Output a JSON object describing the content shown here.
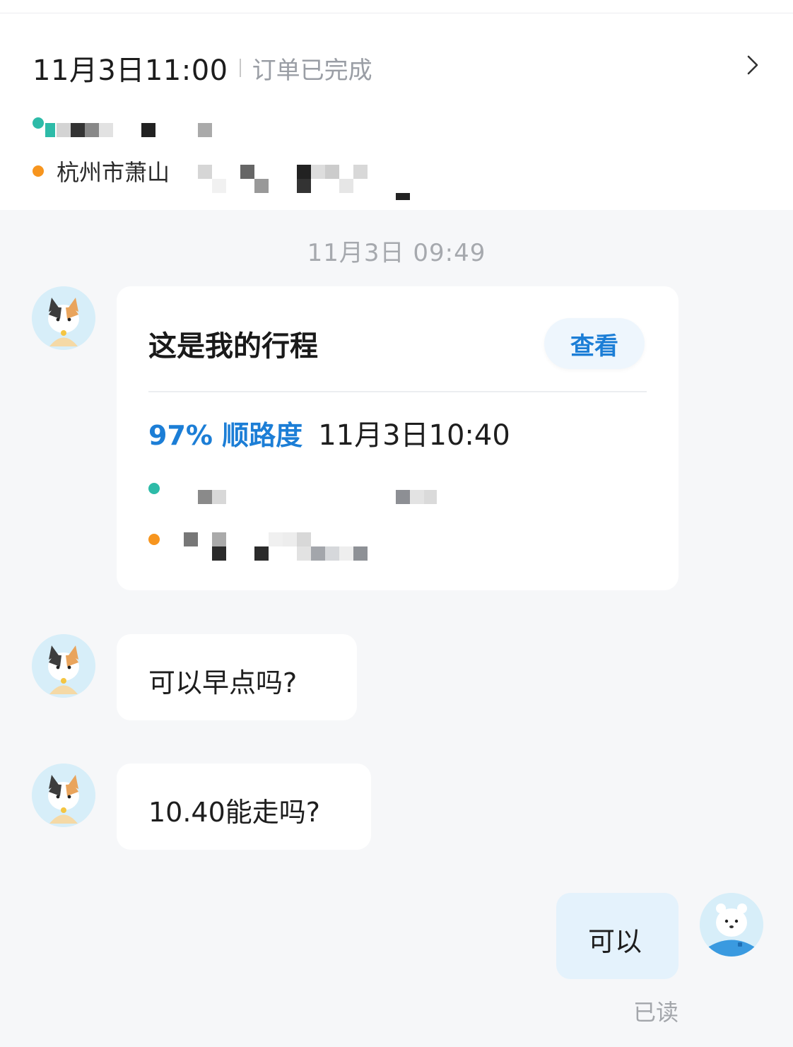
{
  "order": {
    "datetime": "11月3日11:00",
    "status": "订单已完成",
    "destination_partial": "杭州市萧山"
  },
  "chat": {
    "timestamp": "11月3日 09:49",
    "trip_card": {
      "title": "这是我的行程",
      "view_button": "查看",
      "match": "97% 顺路度",
      "time": "11月3日10:40"
    },
    "messages": [
      {
        "text": "可以早点吗?"
      },
      {
        "text": "10.40能走吗?"
      }
    ],
    "reply": {
      "text": "可以"
    },
    "read_status": "已读"
  },
  "colors": {
    "accent": "#1c7ed6",
    "start_dot": "#2dbba8",
    "end_dot": "#f7951e",
    "outgoing_bubble": "#e4f2fc"
  },
  "icons": {
    "chevron": "chevron-right-icon",
    "driver_avatar": "cat-avatar",
    "user_avatar": "polar-bear-avatar"
  }
}
